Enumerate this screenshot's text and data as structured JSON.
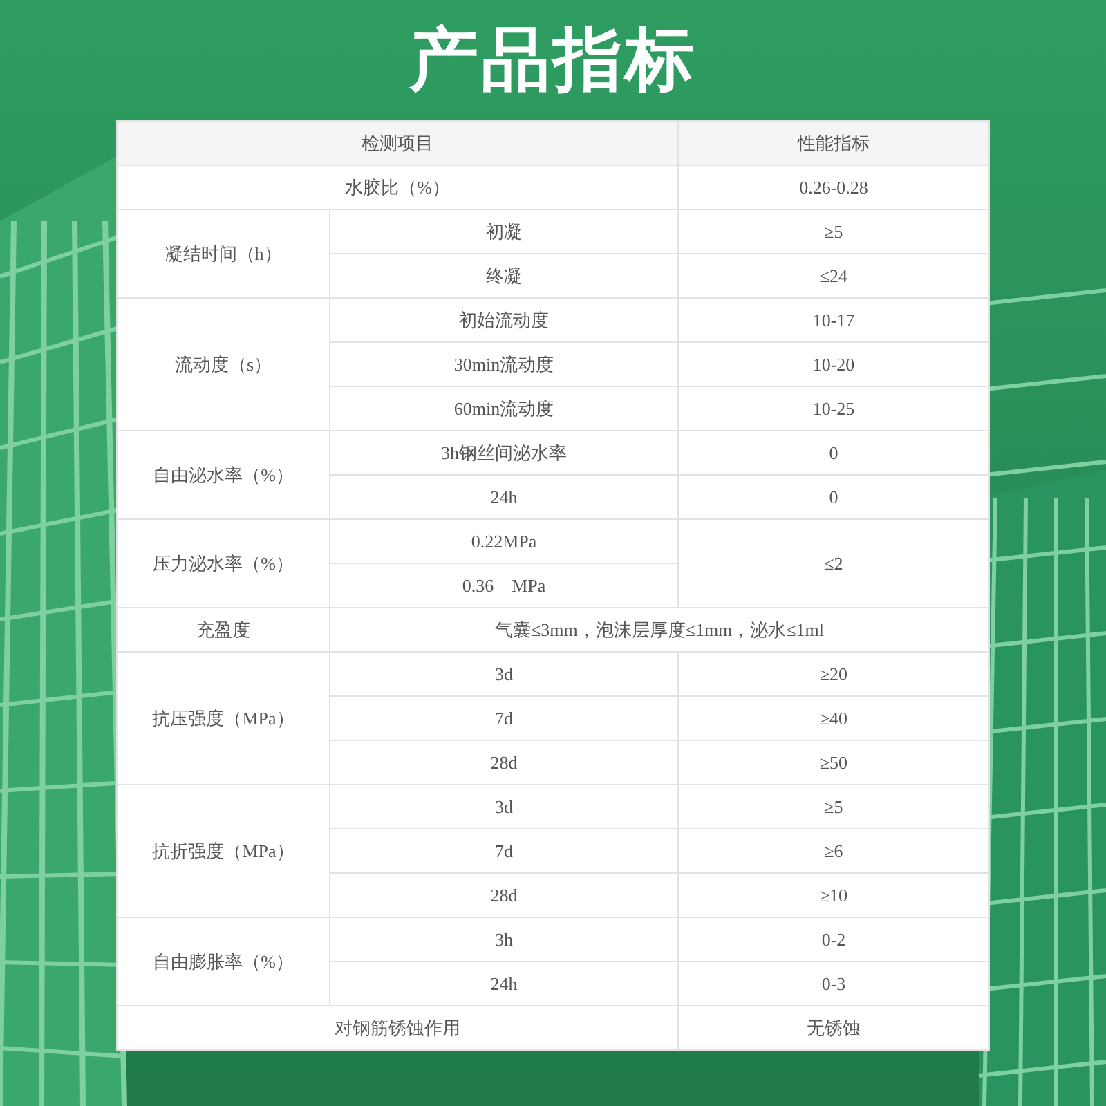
{
  "title": "产品指标",
  "table": {
    "columns": [
      "检测项目",
      "性能指标"
    ],
    "groups": [
      {
        "kind": "pair",
        "label": "水胶比（%）",
        "value": "0.26-0.28"
      },
      {
        "kind": "group",
        "label": "凝结时间（h）",
        "rows": [
          {
            "item": "初凝",
            "value": "≥5"
          },
          {
            "item": "终凝",
            "value": "≤24"
          }
        ]
      },
      {
        "kind": "group",
        "label": "流动度（s）",
        "rows": [
          {
            "item": "初始流动度",
            "value": "10-17"
          },
          {
            "item": "30min流动度",
            "value": "10-20"
          },
          {
            "item": "60min流动度",
            "value": "10-25"
          }
        ]
      },
      {
        "kind": "group",
        "label": "自由泌水率（%）",
        "rows": [
          {
            "item": "3h钢丝间泌水率",
            "value": "0"
          },
          {
            "item": "24h",
            "value": "0"
          }
        ]
      },
      {
        "kind": "shared",
        "label": "压力泌水率（%）",
        "items": [
          "0.22MPa",
          "0.36　MPa"
        ],
        "value": "≤2"
      },
      {
        "kind": "wide",
        "label": "充盈度",
        "value": "气囊≤3mm，泡沫层厚度≤1mm，泌水≤1ml"
      },
      {
        "kind": "group",
        "label": "抗压强度（MPa）",
        "rows": [
          {
            "item": "3d",
            "value": "≥20"
          },
          {
            "item": "7d",
            "value": "≥40"
          },
          {
            "item": "28d",
            "value": "≥50"
          }
        ]
      },
      {
        "kind": "group",
        "label": "抗折强度（MPa）",
        "rows": [
          {
            "item": "3d",
            "value": "≥5"
          },
          {
            "item": "7d",
            "value": "≥6"
          },
          {
            "item": "28d",
            "value": "≥10"
          }
        ]
      },
      {
        "kind": "group",
        "label": "自由膨胀率（%）",
        "rows": [
          {
            "item": "3h",
            "value": "0-2"
          },
          {
            "item": "24h",
            "value": "0-3"
          }
        ]
      },
      {
        "kind": "pair",
        "label": "对钢筋锈蚀作用",
        "value": "无锈蚀"
      }
    ]
  }
}
